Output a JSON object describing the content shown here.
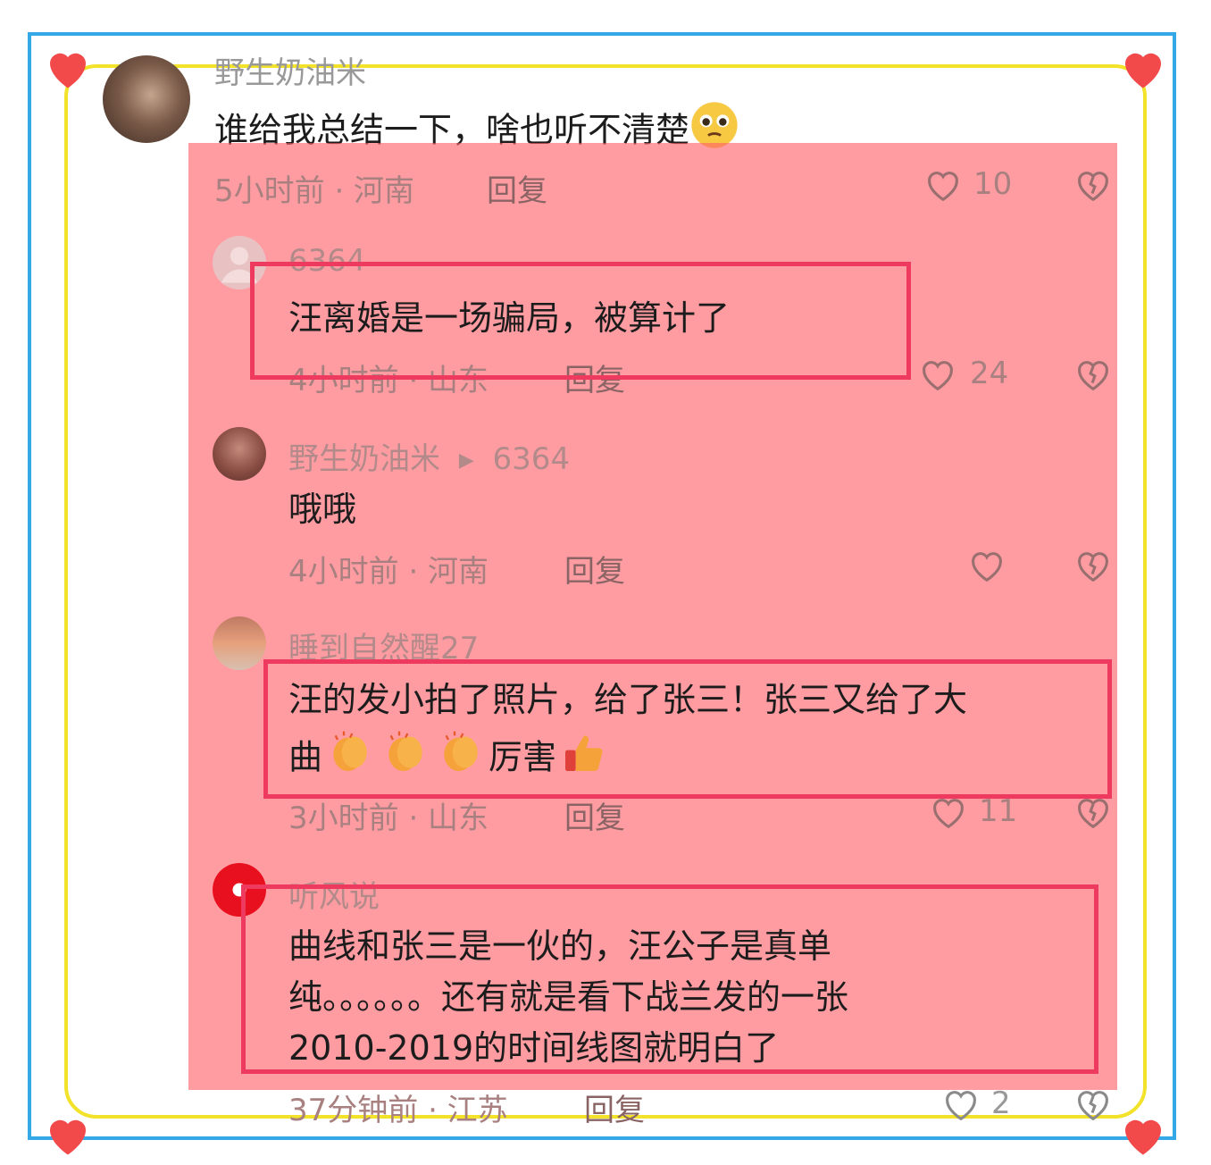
{
  "main_comment": {
    "username": "野生奶油米",
    "text": "谁给我总结一下，啥也听不清楚",
    "time_location": "5小时前 · 河南",
    "reply_label": "回复",
    "likes": "10"
  },
  "replies": [
    {
      "username": "6364",
      "text": "汪离婚是一场骗局，被算计了",
      "time_location": "4小时前 · 山东",
      "reply_label": "回复",
      "likes": "24"
    },
    {
      "username": "野生奶油米",
      "reply_to": "6364",
      "text": "哦哦",
      "time_location": "4小时前 · 河南",
      "reply_label": "回复",
      "likes": ""
    },
    {
      "username": "睡到自然醒27",
      "text_line1": "汪的发小拍了照片，给了张三！张三又给了大",
      "text_line2_a": "曲",
      "text_line2_b": "厉害",
      "time_location": "3小时前 · 山东",
      "reply_label": "回复",
      "likes": "11"
    },
    {
      "username": "听风说",
      "text_line1": "曲线和张三是一伙的，汪公子是真单",
      "text_line2": "纯。。。。。。还有就是看下战兰发的一张",
      "text_line3": "2010-2019的时间线图就明白了",
      "time_location": "37分钟前 · 江苏",
      "reply_label": "回复",
      "likes": "2"
    }
  ],
  "colors": {
    "overlay": "#ff5f69",
    "highlight_box": "#ee3a5e",
    "frame_blue": "#35a8e8",
    "frame_yellow": "#f2e22a"
  }
}
